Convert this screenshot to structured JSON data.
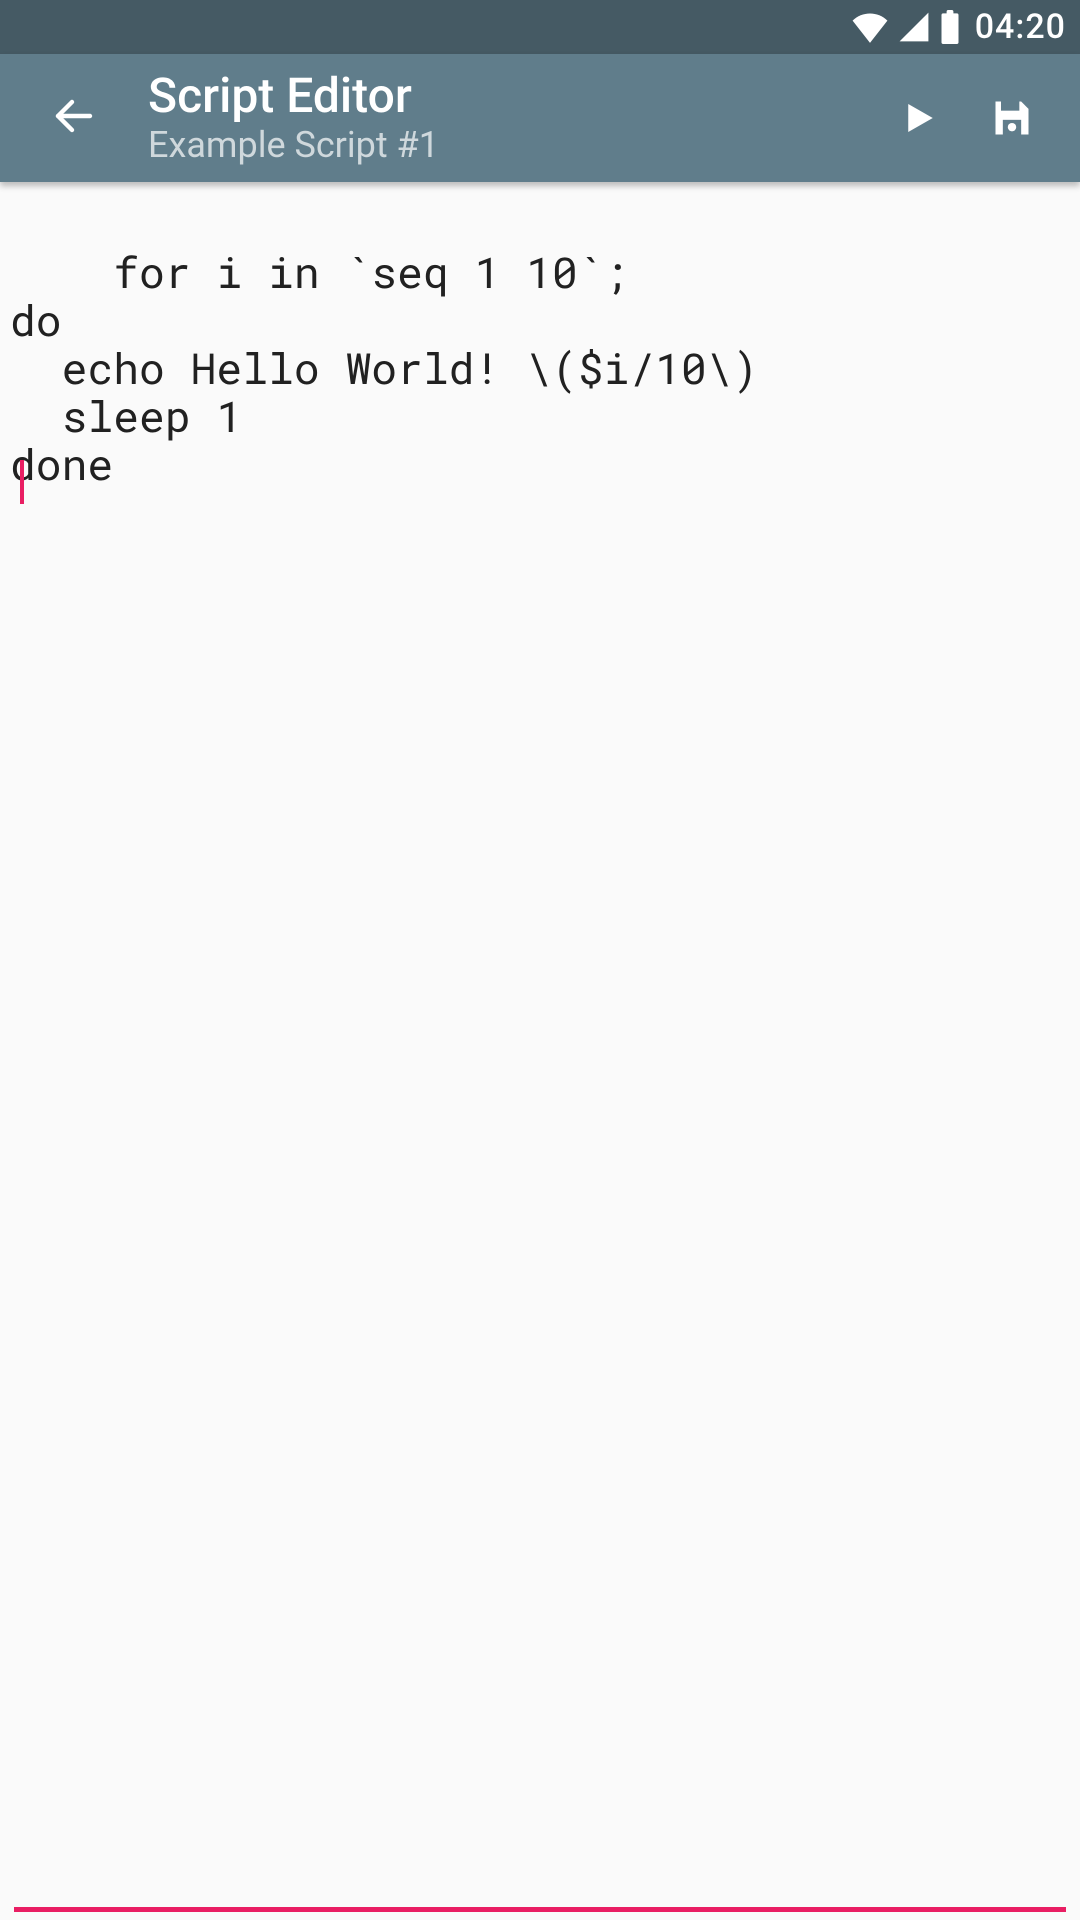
{
  "status": {
    "time": "04:20"
  },
  "appbar": {
    "title": "Script Editor",
    "subtitle": "Example Script #1"
  },
  "editor": {
    "content": "for i in `seq 1 10`;\ndo\n  echo Hello World! \\($i/10\\)\n  sleep 1\ndone"
  }
}
